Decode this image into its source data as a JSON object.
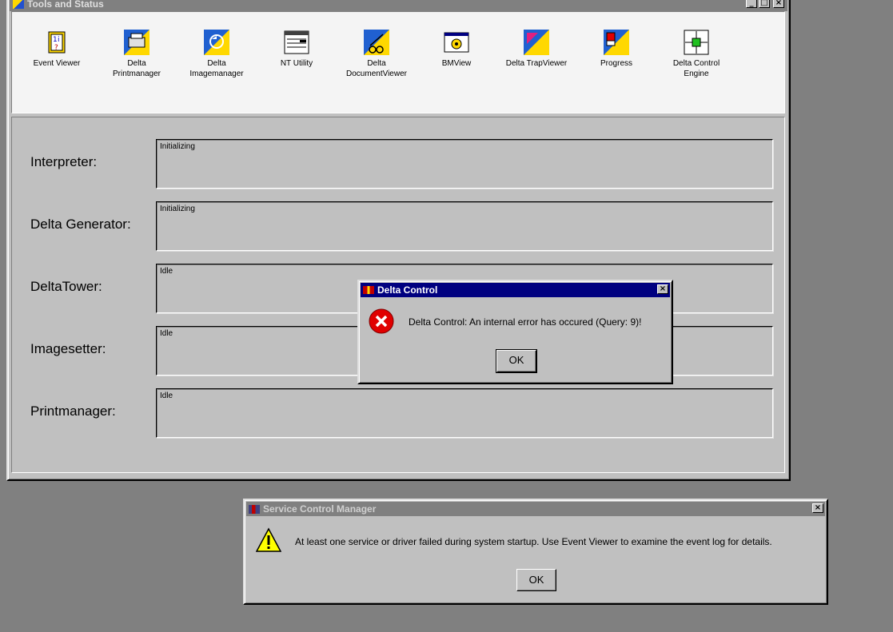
{
  "main_window": {
    "title": "Tools and Status",
    "tools": [
      {
        "label_1": "Event Viewer",
        "label_2": "",
        "icon": "event-viewer-icon"
      },
      {
        "label_1": "Delta",
        "label_2": "Printmanager",
        "icon": "printmanager-icon"
      },
      {
        "label_1": "Delta",
        "label_2": "Imagemanager",
        "icon": "imagemanager-icon"
      },
      {
        "label_1": "NT Utility",
        "label_2": "",
        "icon": "nt-utility-icon"
      },
      {
        "label_1": "Delta",
        "label_2": "DocumentViewer",
        "icon": "document-viewer-icon"
      },
      {
        "label_1": "BMView",
        "label_2": "",
        "icon": "bmview-icon"
      },
      {
        "label_1": "Delta TrapViewer",
        "label_2": "",
        "icon": "trapviewer-icon"
      },
      {
        "label_1": "Progress",
        "label_2": "",
        "icon": "progress-icon"
      },
      {
        "label_1": "Delta Control",
        "label_2": "Engine",
        "icon": "control-engine-icon"
      }
    ],
    "statuses": [
      {
        "label": "Interpreter:",
        "value": "Initializing"
      },
      {
        "label": "Delta Generator:",
        "value": "Initializing"
      },
      {
        "label": "DeltaTower:",
        "value": "Idle"
      },
      {
        "label": "Imagesetter:",
        "value": "Idle"
      },
      {
        "label": "Printmanager:",
        "value": "Idle"
      }
    ]
  },
  "delta_dialog": {
    "title": "Delta Control",
    "message": "Delta Control: An internal error has occured (Query: 9)!",
    "ok_label": "OK",
    "icon": "error-icon"
  },
  "scm_dialog": {
    "title": "Service Control Manager",
    "message": "At least one service or driver failed during system startup.  Use Event Viewer to examine the event log for details.",
    "ok_label": "OK",
    "icon": "warning-icon"
  },
  "colors": {
    "active_title": "#000080",
    "inactive_title": "#808080",
    "desktop": "#808080",
    "face": "#c0c0c0"
  }
}
